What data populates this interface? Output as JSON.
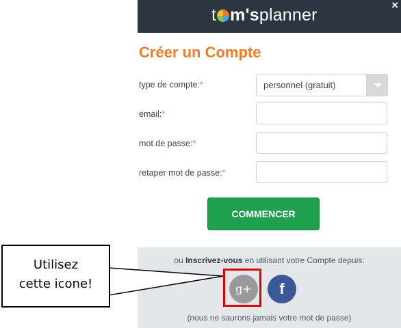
{
  "header": {
    "logo_prefix": "t",
    "logo_bold": "m's",
    "logo_suffix": "planner",
    "close_label": "×"
  },
  "form": {
    "title": "Créer un Compte",
    "account_type_label": "type de compte:",
    "account_type_value": "personnel (gratuit)",
    "email_label": "email:",
    "password_label": "mot de passe:",
    "retype_label": "retaper mot de passe:",
    "required_mark": "*",
    "submit_label": "COMMENCER"
  },
  "footer": {
    "prefix": "ou ",
    "bold": "Inscrivez-vous",
    "suffix": " en utilisant votre Compte depuis:",
    "gplus_label": "g+",
    "facebook_label": "f",
    "note": "(nous ne saurons jamais votre mot de passe)"
  },
  "callout": {
    "line1": "Utilisez",
    "line2": "cette icone!"
  },
  "colors": {
    "header_bg": "#2d3541",
    "accent_orange": "#f07a26",
    "button_green": "#1ea04e",
    "facebook_blue": "#3b5998",
    "highlight_red": "#e00000"
  }
}
